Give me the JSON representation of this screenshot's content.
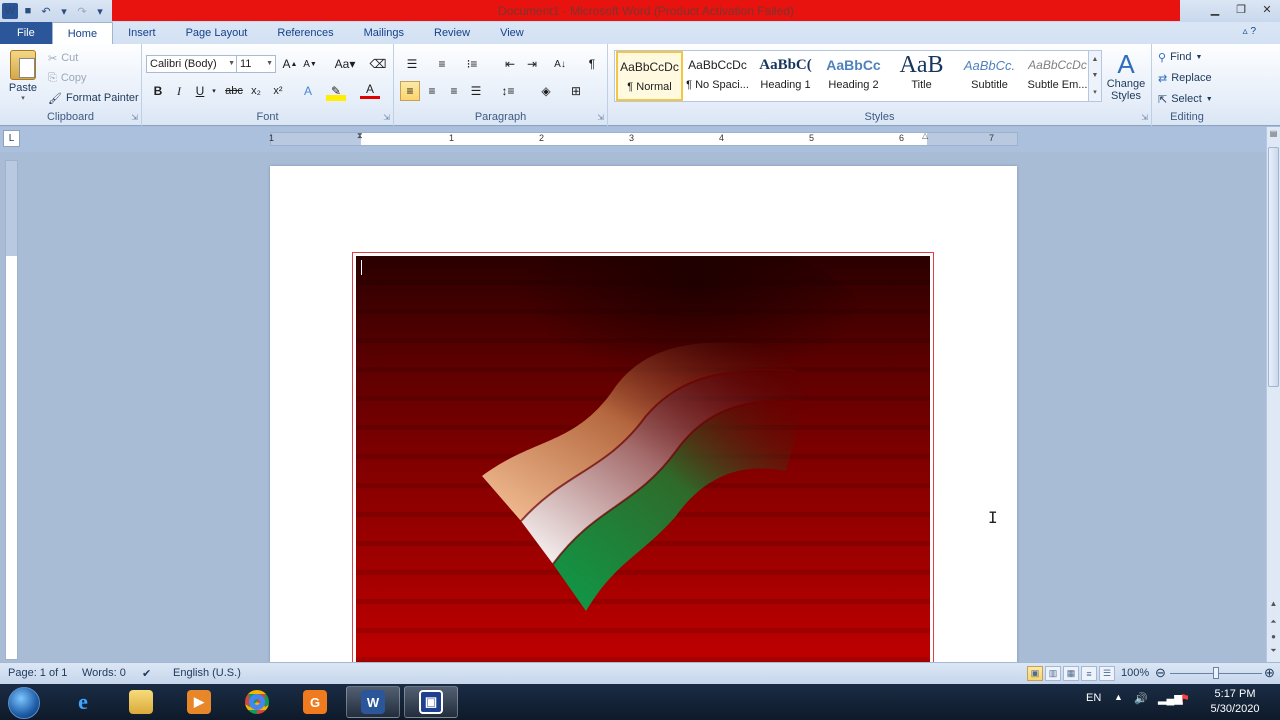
{
  "window": {
    "title": "Document1 - Microsoft Word (Product Activation Failed)"
  },
  "tabs": [
    "File",
    "Home",
    "Insert",
    "Page Layout",
    "References",
    "Mailings",
    "Review",
    "View"
  ],
  "clipboard": {
    "paste": "Paste",
    "cut": "Cut",
    "copy": "Copy",
    "format_painter": "Format Painter",
    "group_label": "Clipboard"
  },
  "font": {
    "name": "Calibri (Body)",
    "size": "11",
    "group_label": "Font"
  },
  "paragraph": {
    "group_label": "Paragraph"
  },
  "styles": {
    "group_label": "Styles",
    "items": [
      {
        "sample": "AaBbCcDc",
        "name": "¶ Normal"
      },
      {
        "sample": "AaBbCcDc",
        "name": "¶ No Spaci..."
      },
      {
        "sample": "AaBbC(",
        "name": "Heading 1"
      },
      {
        "sample": "AaBbCc",
        "name": "Heading 2"
      },
      {
        "sample": "AaB",
        "name": "Title"
      },
      {
        "sample": "AaBbCc.",
        "name": "Subtitle"
      },
      {
        "sample": "AaBbCcDc",
        "name": "Subtle Em..."
      }
    ],
    "change_styles": "Change Styles"
  },
  "editing": {
    "find": "Find",
    "replace": "Replace",
    "select": "Select",
    "group_label": "Editing"
  },
  "ruler": {
    "numbers": [
      "1",
      "1",
      "2",
      "3",
      "4",
      "5",
      "6",
      "7"
    ],
    "corner": "L"
  },
  "status": {
    "page": "Page: 1 of 1",
    "words": "Words: 0",
    "language": "English (U.S.)",
    "zoom": "100%"
  },
  "taskbar": {
    "lang": "EN",
    "time": "5:17 PM",
    "date": "5/30/2020"
  },
  "colors": {
    "file_tab": "#2b579a",
    "activation_bar": "#e8120f",
    "flag_saffron": "#f2b48a",
    "flag_green": "#0e9b49"
  }
}
